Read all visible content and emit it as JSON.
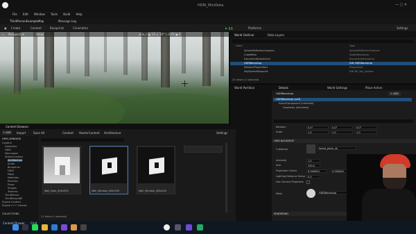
{
  "titlebar": {
    "project": "ThirdPersonExampleMap",
    "tab": "Message Log",
    "window_title": "HDRI_MiniData"
  },
  "menu": [
    "File",
    "Edit",
    "Window",
    "Tools",
    "Build",
    "Help"
  ],
  "toolbar": {
    "create": "Create",
    "content": "Content",
    "blueprints": "Blueprints",
    "cinematics": "Cinematics",
    "platforms": "Platforms",
    "settings": "Settings"
  },
  "viewport": {
    "perspective": "Perspective",
    "lit": "Show"
  },
  "outliner": {
    "tabs": [
      "World Outliner",
      "Data Layers"
    ],
    "col_label": "Label",
    "col_type": "Type",
    "rows": [
      {
        "label": "SphereReflectionCapture",
        "type": "SphereReflectionCapture"
      },
      {
        "label": "CubeMesh",
        "type": "StaticMeshActor"
      },
      {
        "label": "DocumentationActor1",
        "type": "DocumentationActor"
      },
      {
        "label": "HDRIBackdrop",
        "type": "Edit HDRIBackdrop"
      },
      {
        "label": "NetworkPlayerStart",
        "type": "PlayerStart"
      },
      {
        "label": "SkySphereBlueprint",
        "type": "Edit BP_Sky_Sphere"
      }
    ],
    "status": "24 actors (1 selected)"
  },
  "details": {
    "tabs": [
      "Details",
      "World Settings",
      "Place Actors"
    ],
    "world_partition": "World Partition",
    "actor": "HDRIBackdrop",
    "self": "HDRIBackdrop (self)",
    "components": [
      "SceneComponent (Inherited)",
      "Geometry (Inherited)"
    ],
    "add": "+ ADD",
    "transform": [
      {
        "label": "Rotation",
        "values": [
          "0.0°",
          "0.0°",
          "0.0°"
        ]
      },
      {
        "label": "Scale",
        "values": [
          "1.0",
          "1.0",
          "1.0"
        ]
      }
    ],
    "section": "HDRI BACKDROP",
    "props": [
      {
        "label": "Cubemap",
        "value": "forest_pines_4k"
      },
      {
        "label": "Intensity",
        "value": "1.0"
      },
      {
        "label": "Size",
        "value": "150.0"
      },
      {
        "label": "Projection Center",
        "value": "0.000000"
      },
      {
        "label": "Lighting Distance Factor",
        "value": "0.5"
      },
      {
        "label": "Use Camera Projection",
        "value": ""
      },
      {
        "label": "Mesh",
        "value": "HDRIBackdrop"
      }
    ],
    "rendering": "RENDERING"
  },
  "content_browser": {
    "tab": "Content Browser",
    "add": "+ ADD",
    "import": "Import",
    "save_all": "Save All",
    "path": [
      "Content",
      "StarterContent",
      "Architecture"
    ],
    "settings": "Settings",
    "root": "HDRI_MINIDATA",
    "tree": [
      "Content",
      "Geometry",
      "HDRI",
      "Mannequin",
      "StarterContent",
      "Architecture",
      "Audio",
      "Blueprints",
      "HDRI",
      "Maps",
      "Materials",
      "Particles",
      "Props",
      "Shapes",
      "Textures",
      "ThirdPerson",
      "ThirdPersonBP",
      "Engine Content",
      "Engine C++ Classes"
    ],
    "items": [
      "Wall_Door_400x300",
      "Wall_Window_400x300",
      "Wall_Window_400x400"
    ],
    "count": "11 items (1 selected)",
    "collections": "COLLECTIONS"
  },
  "statusbar": {
    "content_drawer": "Content Drawer",
    "cmd": "Cmd"
  },
  "colors": {
    "accent": "#1f4f7a",
    "play": "#3fae3a"
  }
}
